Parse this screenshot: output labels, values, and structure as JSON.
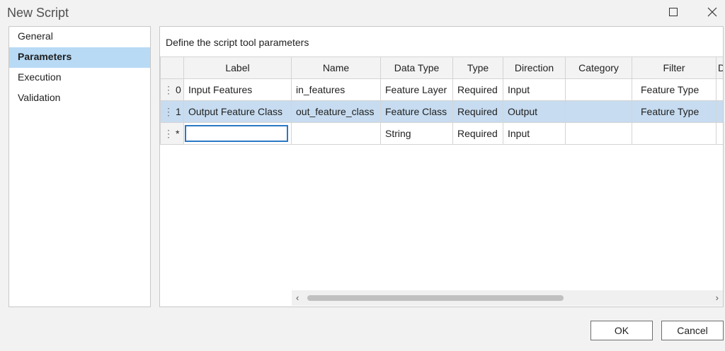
{
  "window": {
    "title": "New Script",
    "maximize_icon": "maximize-icon",
    "close_icon": "close-icon"
  },
  "sidebar": {
    "items": [
      {
        "label": "General",
        "active": false
      },
      {
        "label": "Parameters",
        "active": true
      },
      {
        "label": "Execution",
        "active": false
      },
      {
        "label": "Validation",
        "active": false
      }
    ]
  },
  "main": {
    "heading": "Define the script tool parameters",
    "columns": [
      "Label",
      "Name",
      "Data Type",
      "Type",
      "Direction",
      "Category",
      "Filter",
      "D"
    ],
    "rows": [
      {
        "index": "0",
        "label": "Input Features",
        "name": "in_features",
        "data_type": "Feature Layer",
        "type": "Required",
        "direction": "Input",
        "category": "",
        "filter": "Feature Type",
        "selected": false
      },
      {
        "index": "1",
        "label": "Output Feature Class",
        "name": "out_feature_class",
        "data_type": "Feature Class",
        "type": "Required",
        "direction": "Output",
        "category": "",
        "filter": "Feature Type",
        "selected": true
      },
      {
        "index": "*",
        "label": "",
        "name": "",
        "data_type": "String",
        "type": "Required",
        "direction": "Input",
        "category": "",
        "filter": "",
        "selected": false
      }
    ],
    "scroll_left_glyph": "‹",
    "scroll_right_glyph": "›"
  },
  "footer": {
    "ok_label": "OK",
    "cancel_label": "Cancel"
  },
  "colors": {
    "selected_nav": "#b8daf5",
    "selected_row": "#c7dcf0",
    "edit_border": "#2b78c4"
  }
}
